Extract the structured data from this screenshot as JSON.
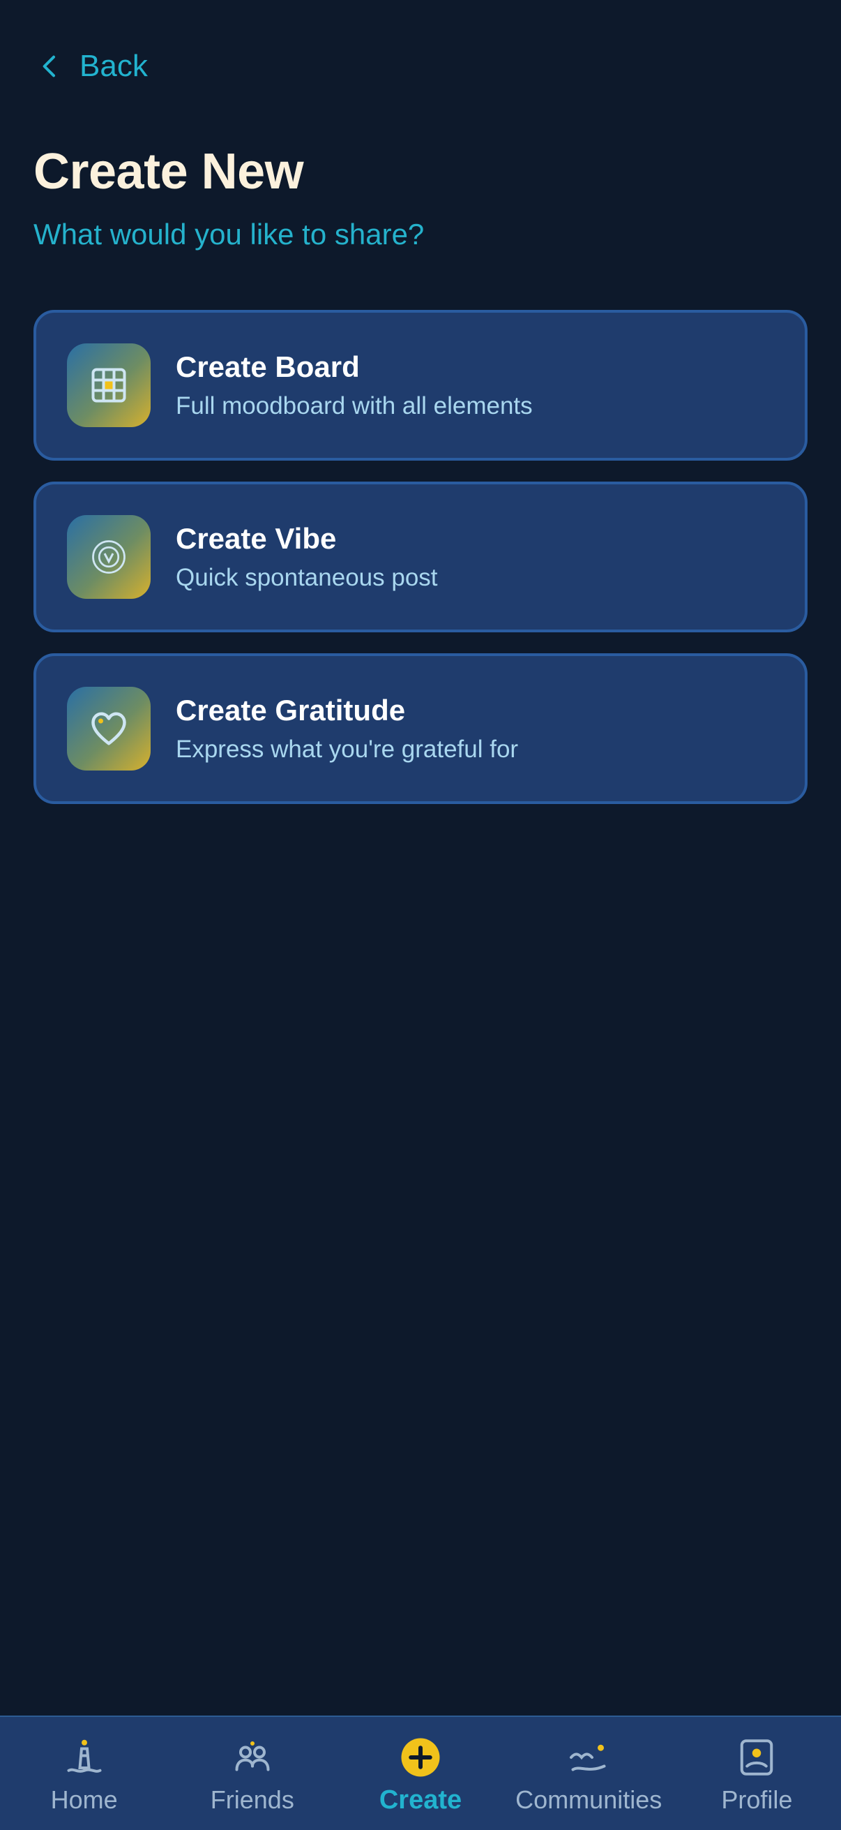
{
  "header": {
    "back_label": "Back",
    "title": "Create New",
    "subtitle": "What would you like to share?"
  },
  "options": [
    {
      "title": "Create Board",
      "description": "Full moodboard with all elements",
      "icon": "grid-icon"
    },
    {
      "title": "Create Vibe",
      "description": "Quick spontaneous post",
      "icon": "vibe-spiral-icon"
    },
    {
      "title": "Create Gratitude",
      "description": "Express what you're grateful for",
      "icon": "heart-icon"
    }
  ],
  "nav": {
    "items": [
      {
        "label": "Home",
        "icon": "lighthouse-icon"
      },
      {
        "label": "Friends",
        "icon": "friends-icon"
      },
      {
        "label": "Create",
        "icon": "plus-circle-icon",
        "active": true
      },
      {
        "label": "Communities",
        "icon": "waves-icon"
      },
      {
        "label": "Profile",
        "icon": "profile-card-icon"
      }
    ]
  },
  "colors": {
    "background": "#0d192b",
    "card": "#1f3c6d",
    "accent": "#22b3cf",
    "highlight": "#f1c21b",
    "title": "#fbf1dd"
  }
}
